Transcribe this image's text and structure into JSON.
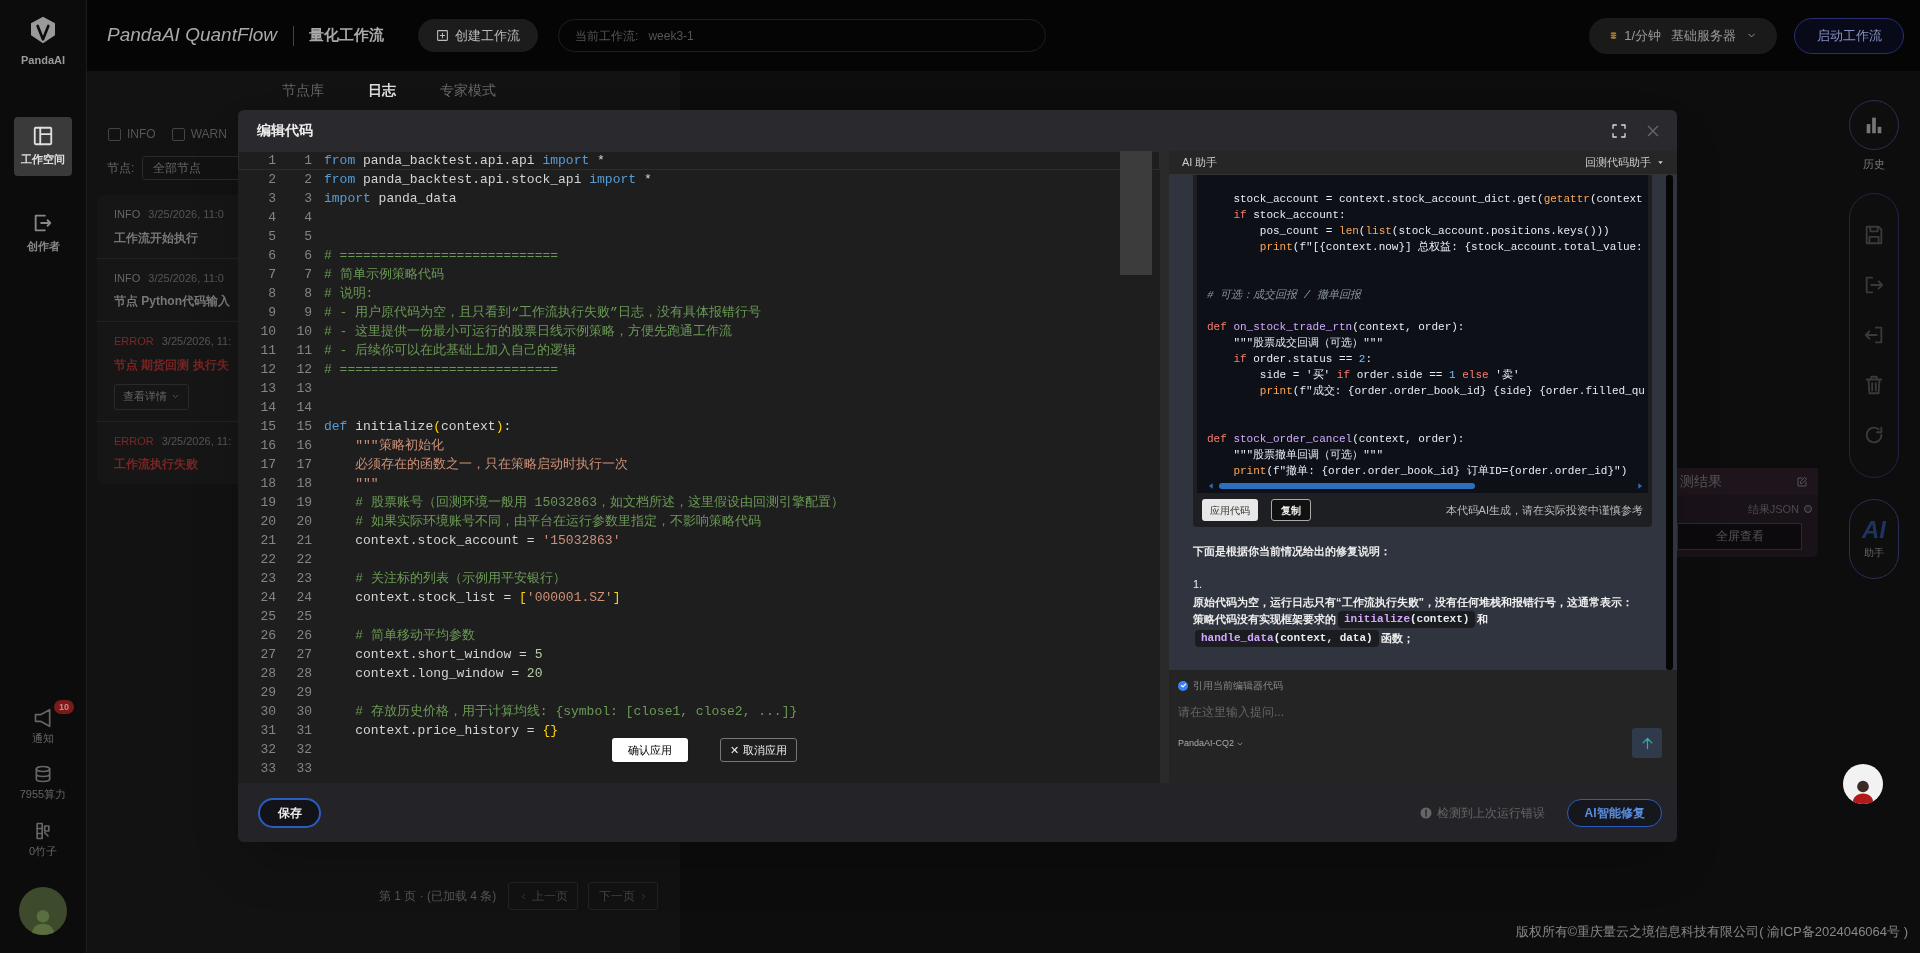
{
  "sidebar": {
    "logo_text": "PandaAI",
    "items": [
      {
        "kind": "workspace",
        "label": "工作空间",
        "selected": true
      },
      {
        "kind": "creator",
        "label": "创作者",
        "selected": false
      }
    ],
    "bottom": [
      {
        "kind": "notify",
        "label": "通知",
        "badge": "10"
      },
      {
        "kind": "compute",
        "label": "7955算力"
      },
      {
        "kind": "bamboo",
        "label": "0竹子"
      }
    ]
  },
  "header": {
    "app_title": "PandaAI QuantFlow",
    "subtitle": "量化工作流",
    "create_button": "创建工作流",
    "workflow_field": {
      "label": "当前工作流:",
      "value": "week3-1"
    },
    "server": {
      "rate": "1/分钟",
      "name": "基础服务器"
    },
    "start_button": "启动工作流"
  },
  "panel_tabs": [
    {
      "label": "节点库",
      "selected": false
    },
    {
      "label": "日志",
      "selected": true
    },
    {
      "label": "专家模式",
      "selected": false
    }
  ],
  "log_filters": [
    {
      "label": "INFO",
      "checked": false
    },
    {
      "label": "WARN",
      "checked": false
    }
  ],
  "node_filter": {
    "label": "节点:",
    "value": "全部节点"
  },
  "logs": [
    {
      "kind": "info",
      "level": "INFO",
      "time": "3/25/2026, 11:0",
      "message": "工作流开始执行"
    },
    {
      "kind": "info",
      "level": "INFO",
      "time": "3/25/2026, 11:0",
      "message": "节点 Python代码输入"
    },
    {
      "kind": "error",
      "level": "ERROR",
      "time": "3/25/2026, 11:",
      "message": "节点 期货回测 执行失",
      "detail_button": "查看详情"
    },
    {
      "kind": "error",
      "level": "ERROR",
      "time": "3/25/2026, 11:",
      "message": "工作流执行失败"
    }
  ],
  "pagination": {
    "info": "第 1 页 · (已加载 4 条)",
    "prev": "上一页",
    "next": "下一页"
  },
  "toolbar": {
    "history": "历史",
    "ai_label": "AI",
    "ai_caption": "助手"
  },
  "node_card": {
    "title": "测结果",
    "output": "结果JSON",
    "button": "全屏查看"
  },
  "copyright": "版权所有©重庆量云之境信息科技有限公司( 渝ICP备2024046064号 )",
  "modal": {
    "title": "编辑代码",
    "editor": {
      "lines": [
        {
          "numbers": [
            "1",
            "1"
          ],
          "tokens": [
            {
              "kind": "keyword",
              "text": "from"
            },
            {
              "kind": "plain",
              "text": " panda_backtest.api.api "
            },
            {
              "kind": "keyword",
              "text": "import"
            },
            {
              "kind": "plain",
              "text": " *"
            }
          ]
        },
        {
          "numbers": [
            "2",
            "2"
          ],
          "tokens": [
            {
              "kind": "keyword",
              "text": "from"
            },
            {
              "kind": "plain",
              "text": " panda_backtest.api.stock_api "
            },
            {
              "kind": "keyword",
              "text": "import"
            },
            {
              "kind": "plain",
              "text": " *"
            }
          ]
        },
        {
          "numbers": [
            "3",
            "3"
          ],
          "tokens": [
            {
              "kind": "keyword",
              "text": "import"
            },
            {
              "kind": "plain",
              "text": " panda_data"
            }
          ]
        },
        {
          "numbers": [
            "4",
            "4"
          ]
        },
        {
          "numbers": [
            "5",
            "5"
          ]
        },
        {
          "numbers": [
            "6",
            "6"
          ],
          "tokens": [
            {
              "kind": "comment",
              "text": "# ============================"
            }
          ]
        },
        {
          "numbers": [
            "7",
            "7"
          ],
          "tokens": [
            {
              "kind": "comment",
              "text": "# 简单示例策略代码"
            }
          ]
        },
        {
          "numbers": [
            "8",
            "8"
          ],
          "tokens": [
            {
              "kind": "comment",
              "text": "# 说明:"
            }
          ]
        },
        {
          "numbers": [
            "9",
            "9"
          ],
          "tokens": [
            {
              "kind": "comment",
              "text": "# - 用户原代码为空，且只看到“工作流执行失败”日志，没有具体报错行号"
            }
          ]
        },
        {
          "numbers": [
            "10",
            "10"
          ],
          "tokens": [
            {
              "kind": "comment",
              "text": "# - 这里提供一份最小可运行的股票日线示例策略，方便先跑通工作流"
            }
          ]
        },
        {
          "numbers": [
            "11",
            "11"
          ],
          "tokens": [
            {
              "kind": "comment",
              "text": "# - 后续你可以在此基础上加入自己的逻辑"
            }
          ]
        },
        {
          "numbers": [
            "12",
            "12"
          ],
          "tokens": [
            {
              "kind": "comment",
              "text": "# ============================"
            }
          ]
        },
        {
          "numbers": [
            "13",
            "13"
          ]
        },
        {
          "numbers": [
            "14",
            "14"
          ]
        },
        {
          "numbers": [
            "15",
            "15"
          ],
          "tokens": [
            {
              "kind": "keyword",
              "text": "def"
            },
            {
              "kind": "plain",
              "text": " initialize"
            },
            {
              "kind": "bracket",
              "text": "("
            },
            {
              "kind": "plain",
              "text": "context"
            },
            {
              "kind": "bracket",
              "text": ")"
            },
            {
              "kind": "plain",
              "text": ":"
            }
          ]
        },
        {
          "numbers": [
            "16",
            "16"
          ],
          "tokens": [
            {
              "kind": "string",
              "text": "    \"\"\"策略初始化"
            }
          ]
        },
        {
          "numbers": [
            "17",
            "17"
          ],
          "tokens": [
            {
              "kind": "string",
              "text": "    必须存在的函数之一，只在策略启动时执行一次"
            }
          ]
        },
        {
          "numbers": [
            "18",
            "18"
          ],
          "tokens": [
            {
              "kind": "string",
              "text": "    \"\"\""
            }
          ]
        },
        {
          "numbers": [
            "19",
            "19"
          ],
          "tokens": [
            {
              "kind": "comment",
              "text": "    # 股票账号（回测环境一般用 15032863，如文档所述，这里假设由回测引擎配置）"
            }
          ]
        },
        {
          "numbers": [
            "20",
            "20"
          ],
          "tokens": [
            {
              "kind": "comment",
              "text": "    # 如果实际环境账号不同，由平台在运行参数里指定，不影响策略代码"
            }
          ]
        },
        {
          "numbers": [
            "21",
            "21"
          ],
          "tokens": [
            {
              "kind": "plain",
              "text": "    context.stock_account = "
            },
            {
              "kind": "string",
              "text": "'15032863'"
            }
          ]
        },
        {
          "numbers": [
            "22",
            "22"
          ]
        },
        {
          "numbers": [
            "23",
            "23"
          ],
          "tokens": [
            {
              "kind": "comment",
              "text": "    # 关注标的列表（示例用平安银行）"
            }
          ]
        },
        {
          "numbers": [
            "24",
            "24"
          ],
          "tokens": [
            {
              "kind": "plain",
              "text": "    context.stock_list = "
            },
            {
              "kind": "bracket",
              "text": "["
            },
            {
              "kind": "string",
              "text": "'000001.SZ'"
            },
            {
              "kind": "bracket",
              "text": "]"
            }
          ]
        },
        {
          "numbers": [
            "25",
            "25"
          ]
        },
        {
          "numbers": [
            "26",
            "26"
          ],
          "tokens": [
            {
              "kind": "comment",
              "text": "    # 简单移动平均参数"
            }
          ]
        },
        {
          "numbers": [
            "27",
            "27"
          ],
          "tokens": [
            {
              "kind": "plain",
              "text": "    context.short_window = "
            },
            {
              "kind": "number",
              "text": "5"
            }
          ]
        },
        {
          "numbers": [
            "28",
            "28"
          ],
          "tokens": [
            {
              "kind": "plain",
              "text": "    context.long_window = "
            },
            {
              "kind": "number",
              "text": "20"
            }
          ]
        },
        {
          "numbers": [
            "29",
            "29"
          ]
        },
        {
          "numbers": [
            "30",
            "30"
          ],
          "tokens": [
            {
              "kind": "comment",
              "text": "    # 存放历史价格，用于计算均线: {symbol: [close1, close2, ...]}"
            }
          ]
        },
        {
          "numbers": [
            "31",
            "31"
          ],
          "tokens": [
            {
              "kind": "plain",
              "text": "    context.price_history = "
            },
            {
              "kind": "bracket",
              "text": "{}"
            }
          ]
        },
        {
          "numbers": [
            "32",
            "32"
          ]
        },
        {
          "numbers": [
            "33",
            "33"
          ]
        }
      ]
    },
    "overlay_buttons": {
      "confirm": "确认应用",
      "cancel_icon": "✕",
      "cancel": "取消应用"
    },
    "assistant": {
      "title": "AI 助手",
      "mode": "回测代码助手",
      "code_lines": [
        {
          "kind": "code",
          "tokens": [
            {
              "kind": "plain",
              "text": "    stock_account = context.stock_account_dict.get("
            },
            {
              "kind": "builtin",
              "text": "getattr"
            },
            {
              "kind": "plain",
              "text": "(context"
            }
          ]
        },
        {
          "kind": "code",
          "tokens": [
            {
              "kind": "keyword",
              "text": "    if"
            },
            {
              "kind": "plain",
              "text": " stock_account:"
            }
          ]
        },
        {
          "kind": "code",
          "tokens": [
            {
              "kind": "plain",
              "text": "        pos_count = "
            },
            {
              "kind": "builtin",
              "text": "len"
            },
            {
              "kind": "plain",
              "text": "("
            },
            {
              "kind": "builtin",
              "text": "list"
            },
            {
              "kind": "plain",
              "text": "(stock_account.positions.keys()))"
            }
          ]
        },
        {
          "kind": "code",
          "tokens": [
            {
              "kind": "builtin",
              "text": "        print"
            },
            {
              "kind": "plain",
              "text": "(f\"[{context.now}] 总权益: {stock_account.total_value:"
            }
          ]
        },
        {
          "kind": "blank"
        },
        {
          "kind": "blank"
        },
        {
          "kind": "code",
          "tokens": [
            {
              "kind": "comment",
              "text": "# 可选：成交回报 / 撤单回报"
            }
          ]
        },
        {
          "kind": "blank"
        },
        {
          "kind": "code",
          "tokens": [
            {
              "kind": "keyword",
              "text": "def "
            },
            {
              "kind": "func",
              "text": "on_stock_trade_rtn"
            },
            {
              "kind": "plain",
              "text": "(context, order):"
            }
          ]
        },
        {
          "kind": "code",
          "tokens": [
            {
              "kind": "plain",
              "text": "    \"\"\"股票成交回调（可选）\"\"\""
            }
          ]
        },
        {
          "kind": "code",
          "tokens": [
            {
              "kind": "keyword",
              "text": "    if"
            },
            {
              "kind": "plain",
              "text": " order.status == "
            },
            {
              "kind": "number",
              "text": "2"
            },
            {
              "kind": "plain",
              "text": ":"
            }
          ]
        },
        {
          "kind": "code",
          "tokens": [
            {
              "kind": "plain",
              "text": "        side = '买' "
            },
            {
              "kind": "keyword",
              "text": "if"
            },
            {
              "kind": "plain",
              "text": " order.side == "
            },
            {
              "kind": "number",
              "text": "1"
            },
            {
              "kind": "keyword",
              "text": " else"
            },
            {
              "kind": "plain",
              "text": " '卖'"
            }
          ]
        },
        {
          "kind": "code",
          "tokens": [
            {
              "kind": "builtin",
              "text": "        print"
            },
            {
              "kind": "plain",
              "text": "(f\"成交: {order.order_book_id} {side} {order.filled_qu"
            }
          ]
        },
        {
          "kind": "blank"
        },
        {
          "kind": "blank"
        },
        {
          "kind": "code",
          "tokens": [
            {
              "kind": "keyword",
              "text": "def "
            },
            {
              "kind": "func",
              "text": "stock_order_cancel"
            },
            {
              "kind": "plain",
              "text": "(context, order):"
            }
          ]
        },
        {
          "kind": "code",
          "tokens": [
            {
              "kind": "plain",
              "text": "    \"\"\"股票撤单回调（可选）\"\"\""
            }
          ]
        },
        {
          "kind": "code",
          "tokens": [
            {
              "kind": "builtin",
              "text": "    print"
            },
            {
              "kind": "plain",
              "text": "(f\"撤单: {order.order_book_id} 订单ID={order.order_id}\")"
            }
          ]
        }
      ],
      "apply_button": "应用代码",
      "copy_button": "复制",
      "disclaimer": "本代码AI生成，请在实际投资中谨慎参考",
      "heading": "下面是根据你当前情况给出的修复说明：",
      "list_marker": "1.",
      "paragraph": "原始代码为空，运行日志只有“工作流执行失败”，没有任何堆栈和报错行号，这通常表示：",
      "segments": [
        {
          "kind": "text",
          "text": "策略代码没有实现框架要求的"
        },
        {
          "kind": "code",
          "name": "initialize",
          "args": "(context)"
        },
        {
          "kind": "text",
          "text": "和"
        },
        {
          "kind": "code",
          "name": "handle_data",
          "args": "(context, data)"
        },
        {
          "kind": "text",
          "text": "函数；"
        }
      ],
      "quote_editor": {
        "label": "引用当前编辑器代码",
        "checked": true
      },
      "input_placeholder": "请在这里输入提问...",
      "model": "PandaAI-CQ2"
    },
    "footer": {
      "save_button": "保存",
      "warning": "检测到上次运行错误",
      "fix_button": "AI智能修复"
    }
  }
}
